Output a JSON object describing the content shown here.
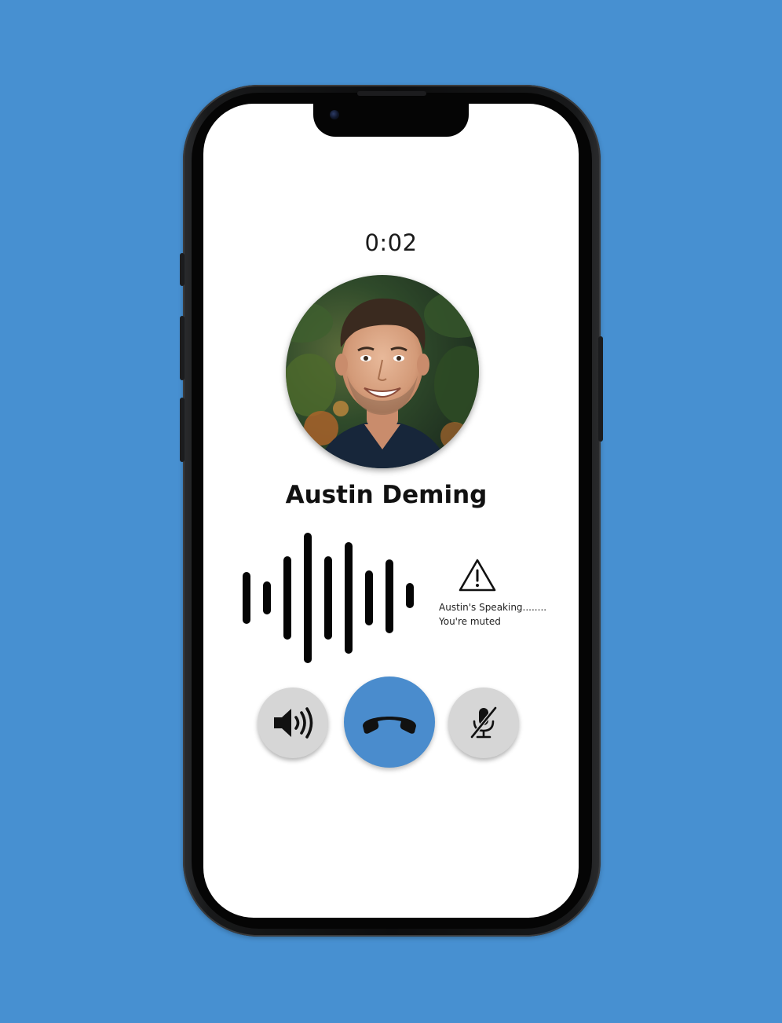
{
  "call": {
    "timer": "0:02",
    "contact_name": "Austin Deming",
    "status_speaking": "Austin's Speaking........",
    "status_muted": "You're muted"
  },
  "controls": {
    "speaker_icon": "speaker-volume-icon",
    "end_call_icon": "hang-up-phone-icon",
    "mute_icon": "microphone-muted-icon",
    "warning_icon": "warning-triangle-icon"
  },
  "colors": {
    "background": "#4790d1",
    "end_call_button": "#4a8ccd",
    "secondary_button": "#d6d6d6",
    "screen": "#ffffff"
  }
}
